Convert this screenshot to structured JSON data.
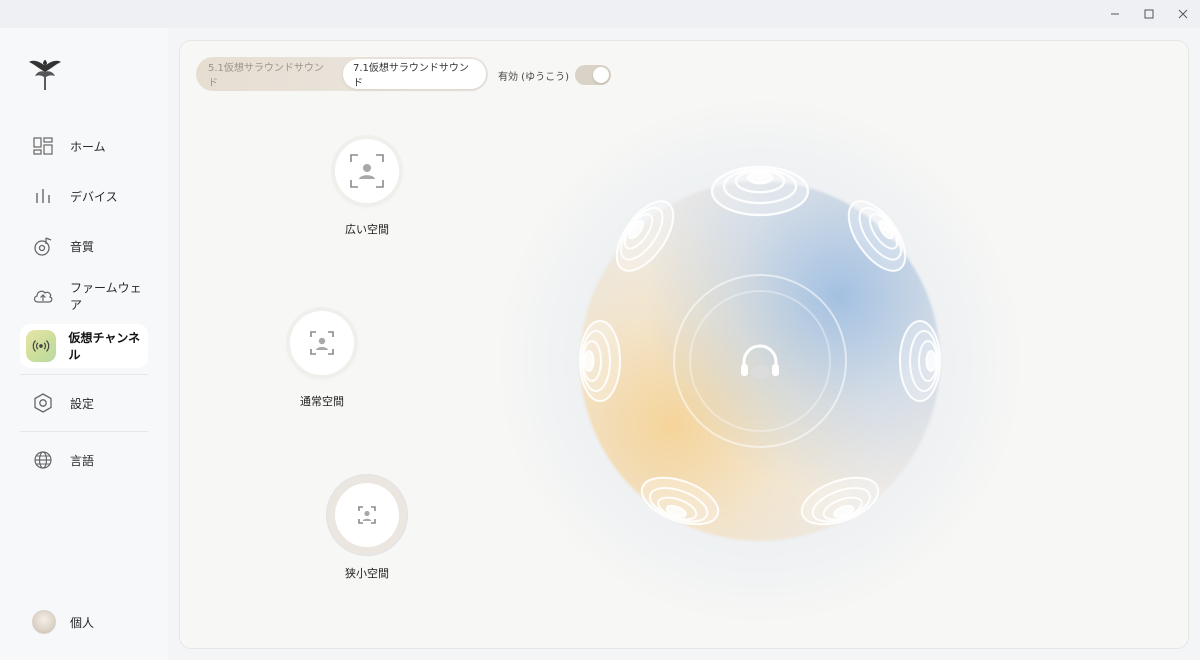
{
  "window": {
    "minimize": "—",
    "maximize": "☐",
    "close": "✕"
  },
  "sidebar": {
    "items": [
      {
        "label": "ホーム",
        "icon": "home-grid-icon"
      },
      {
        "label": "デバイス",
        "icon": "equalizer-bars-icon"
      },
      {
        "label": "音質",
        "icon": "music-note-disc-icon"
      },
      {
        "label": "ファームウェア",
        "icon": "cloud-upload-icon"
      },
      {
        "label": "仮想チャンネル",
        "icon": "surround-waves-icon",
        "active": true
      },
      {
        "label": "設定",
        "icon": "hexagon-settings-icon"
      },
      {
        "label": "言語",
        "icon": "globe-icon"
      }
    ],
    "profile_label": "個人"
  },
  "tabs": {
    "surround51": "5.1仮想サラウンドサウンド",
    "surround71": "7.1仮想サラウンドサウンド",
    "selected": "7.1仮想サラウンドサウンド"
  },
  "enable": {
    "label": "有効 (ゆうこう)",
    "on": true
  },
  "spaces": {
    "wide": "広い空間",
    "normal": "通常空間",
    "small": "狭小空間",
    "selected": "狭小空間"
  },
  "colors": {
    "accent_active": "#c9de9a",
    "sphere_blue": "#96b9e1",
    "sphere_warm": "#f6d08c"
  }
}
